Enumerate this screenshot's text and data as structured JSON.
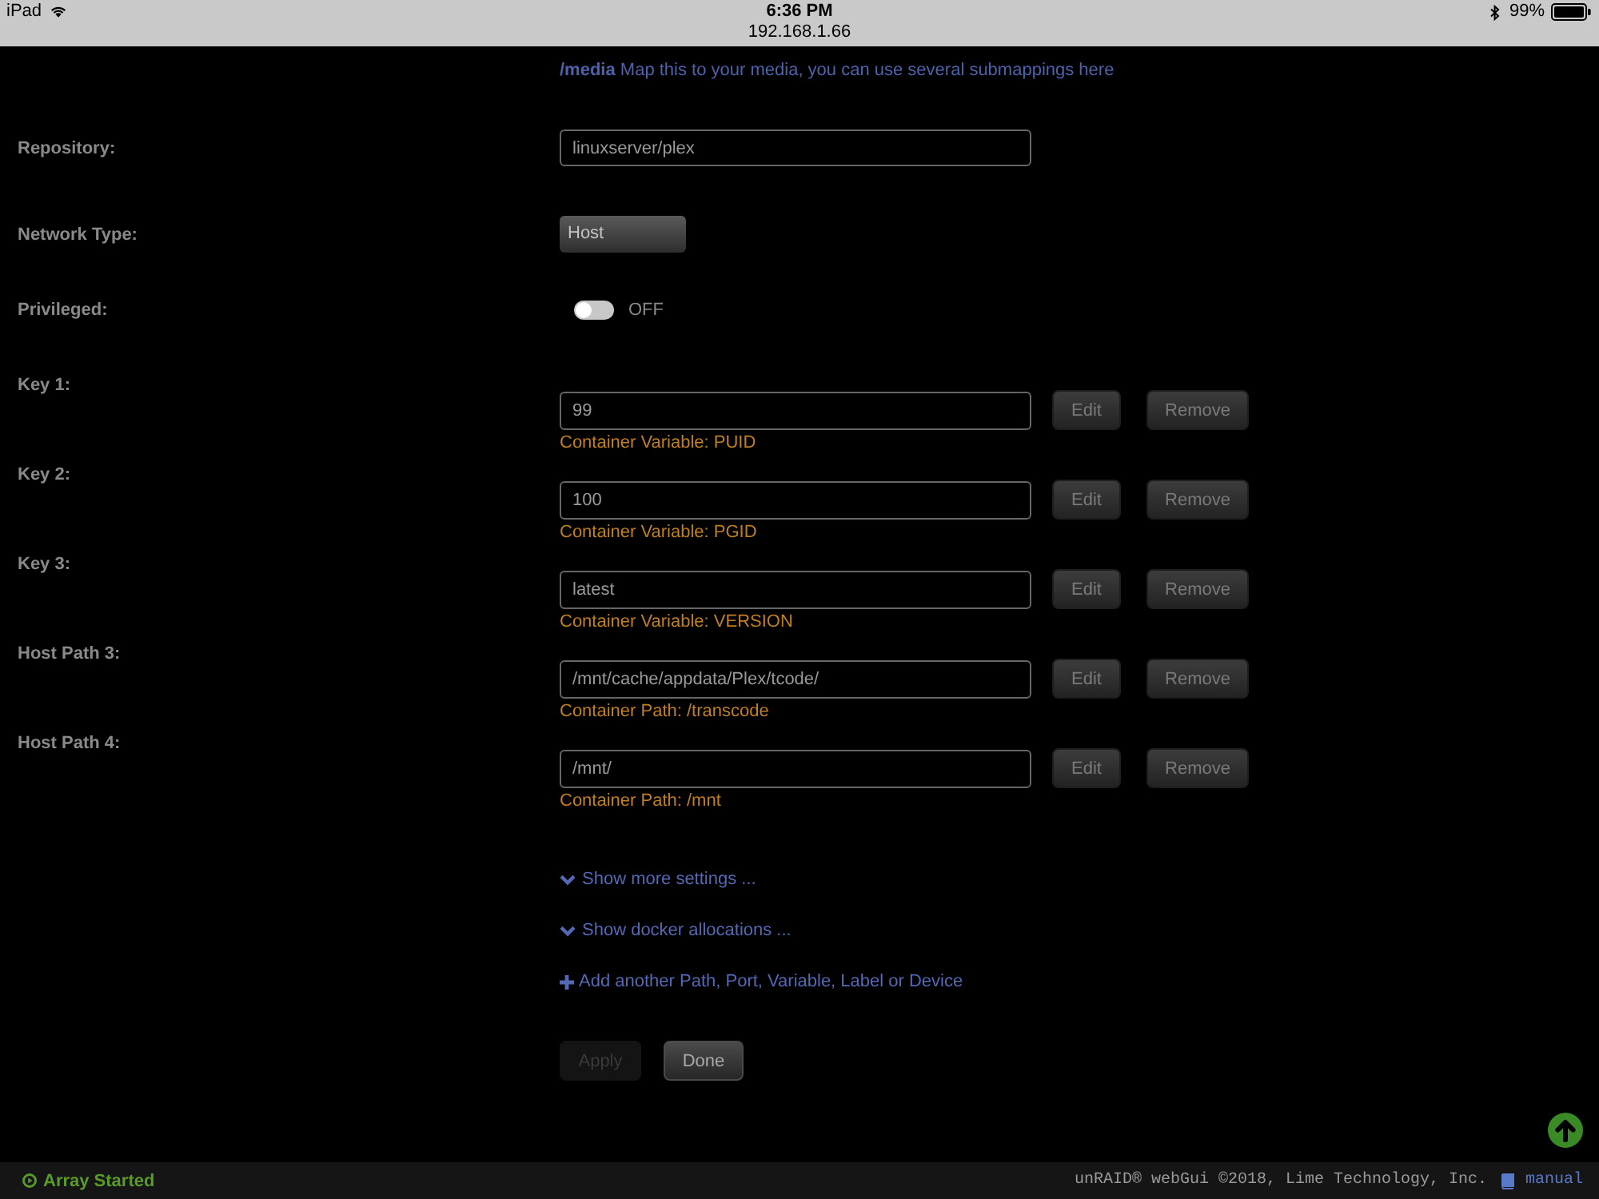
{
  "device_status": {
    "device": "iPad",
    "time": "6:36 PM",
    "address": "192.168.1.66",
    "battery": "99%"
  },
  "help_text": "**/media** Map this to your media, you can use several submappings here",
  "fields": [
    {
      "kind": "text",
      "label": "Repository:",
      "value": "linuxserver/plex"
    },
    {
      "kind": "select",
      "label": "Network Type:",
      "value": "Host"
    },
    {
      "kind": "toggle",
      "label": "Privileged:",
      "on": false,
      "state_text": "OFF"
    },
    {
      "kind": "config",
      "label": "Key 1:",
      "value": "99",
      "caption": "Container Variable: PUID",
      "buttons": [
        "Edit",
        "Remove"
      ]
    },
    {
      "kind": "config",
      "label": "Key 2:",
      "value": "100",
      "caption": "Container Variable: PGID",
      "buttons": [
        "Edit",
        "Remove"
      ]
    },
    {
      "kind": "config",
      "label": "Key 3:",
      "value": "latest",
      "caption": "Container Variable: VERSION",
      "buttons": [
        "Edit",
        "Remove"
      ]
    },
    {
      "kind": "config",
      "label": "Host Path 3:",
      "value": "/mnt/cache/appdata/Plex/tcode/",
      "caption": "Container Path: /transcode",
      "buttons": [
        "Edit",
        "Remove"
      ]
    },
    {
      "kind": "config",
      "label": "Host Path 4:",
      "value": "/mnt/",
      "caption": "Container Path: /mnt",
      "buttons": [
        "Edit",
        "Remove"
      ]
    }
  ],
  "links": [
    {
      "kind": "expand",
      "label": "Show more settings ..."
    },
    {
      "kind": "expand",
      "label": "Show docker allocations ..."
    },
    {
      "kind": "add",
      "label": "Add another Path, Port, Variable, Label or Device"
    }
  ],
  "actions": [
    {
      "label": "Apply",
      "disabled": true
    },
    {
      "label": "Done",
      "disabled": false
    }
  ],
  "footer": {
    "status": "Array Started",
    "copyright": "unRAID® webGui ©2018, Lime Technology, Inc.",
    "manual": "manual"
  }
}
